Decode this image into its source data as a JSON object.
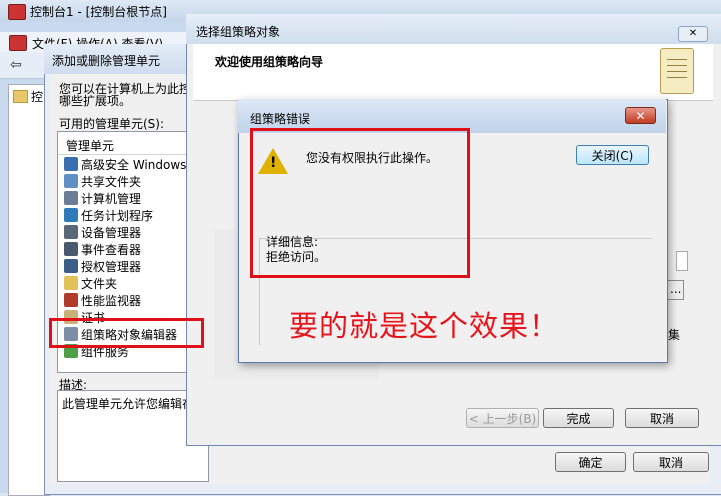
{
  "mmc": {
    "title": "控制台1 - [控制台根节点]",
    "menu_partial": "文件(F)  操作(A)  查看(V)",
    "tree_item_partial": "控"
  },
  "add_remove": {
    "title": "添加或删除管理单元",
    "intro_line1": "您可以在计算机上为此控",
    "intro_line2": "哪些扩展项。",
    "available_label": "可用的管理单元(S):",
    "list_header": "管理单元",
    "items": [
      {
        "label": "高级安全 Windows...",
        "icon": "firewall-icon",
        "color": "#3a6fb0"
      },
      {
        "label": "共享文件夹",
        "icon": "shared-folder-icon",
        "color": "#5f8fc3"
      },
      {
        "label": "计算机管理",
        "icon": "computer-management-icon",
        "color": "#6b7d92"
      },
      {
        "label": "任务计划程序",
        "icon": "clock-icon",
        "color": "#2f7ab8"
      },
      {
        "label": "设备管理器",
        "icon": "device-manager-icon",
        "color": "#5a6778"
      },
      {
        "label": "事件查看器",
        "icon": "event-viewer-icon",
        "color": "#4a5a6e"
      },
      {
        "label": "授权管理器",
        "icon": "authorization-icon",
        "color": "#3b5d86"
      },
      {
        "label": "文件夹",
        "icon": "folder-icon",
        "color": "#e2c15a"
      },
      {
        "label": "性能监视器",
        "icon": "performance-icon",
        "color": "#b23a2a"
      },
      {
        "label": "证书",
        "icon": "certificate-icon",
        "color": "#c9b27a"
      },
      {
        "label": "组策略对象编辑器",
        "icon": "gpo-editor-icon",
        "color": "#7c8ea6"
      },
      {
        "label": "组件服务",
        "icon": "component-services-icon",
        "color": "#4e9f47"
      }
    ],
    "description_label": "描述:",
    "description_text": "此管理单元允许您编辑在",
    "ok_label": "确定",
    "cancel_label": "取消"
  },
  "wizard": {
    "title": "选择组策略对象",
    "heading": "欢迎使用组策略向导",
    "back_label": "< 上一步(B)",
    "finish_label": "完成",
    "cancel_label": "取消",
    "edge_text": "集",
    "edge_button": "..."
  },
  "error_dialog": {
    "title": "组策略错误",
    "message": "您没有权限执行此操作。",
    "close_button": "关闭(C)",
    "detail_label": "详细信息:",
    "detail_text": "拒绝访问。",
    "close_x": "✕"
  },
  "annotation": {
    "text": "要的就是这个效果！",
    "color": "#e0101a"
  }
}
